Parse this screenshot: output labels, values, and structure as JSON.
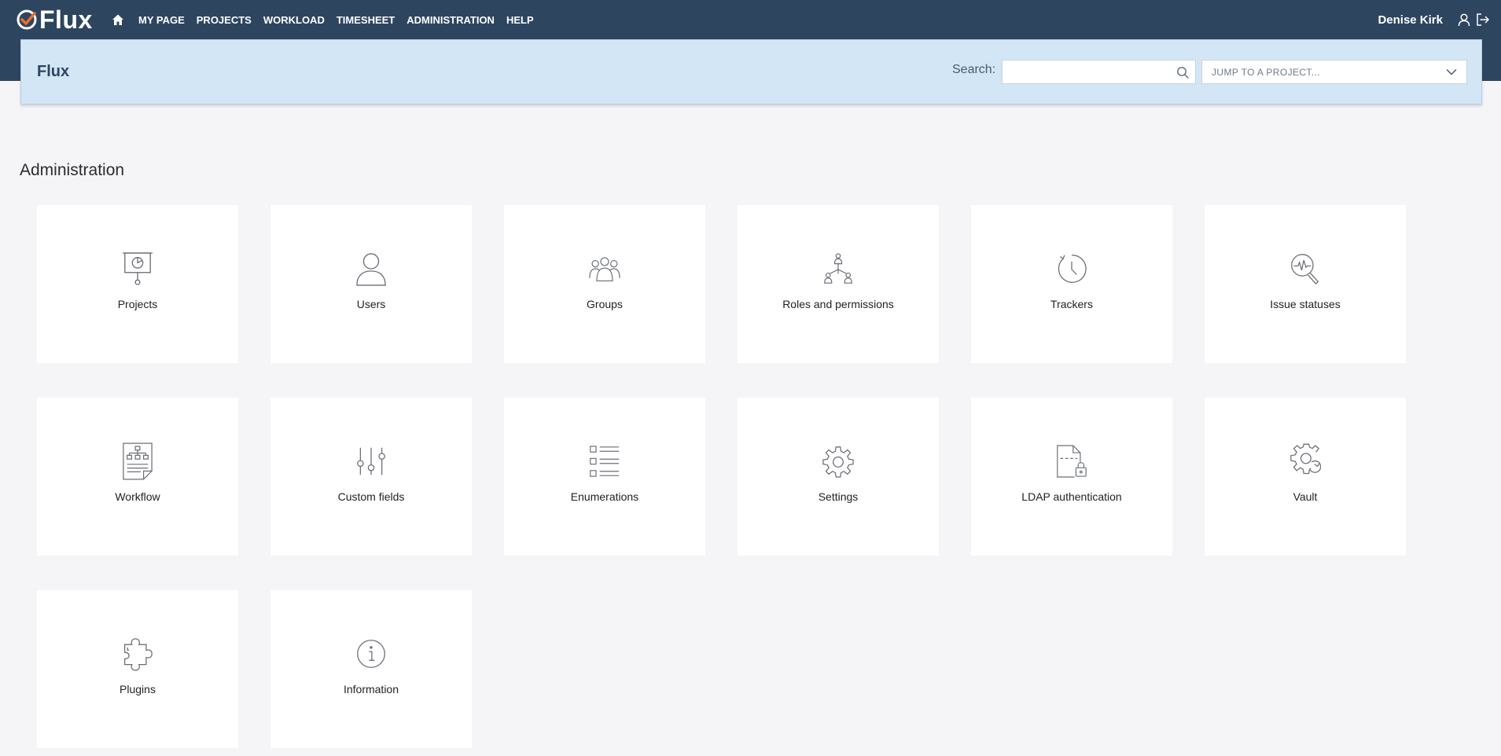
{
  "app": {
    "logo_text": "Flux",
    "brand_color": "#2e4560",
    "accent_color": "#f26b2a"
  },
  "nav": {
    "home_icon": "home-icon",
    "items": [
      {
        "label": "My page"
      },
      {
        "label": "Projects"
      },
      {
        "label": "Workload"
      },
      {
        "label": "Timesheet"
      },
      {
        "label": "Administration"
      },
      {
        "label": "Help"
      }
    ],
    "user_name": "Denise Kirk",
    "user_icon": "user-icon",
    "logout_icon": "logout-icon"
  },
  "header": {
    "title": "Flux",
    "search_label": "Search:",
    "search_value": "",
    "search_placeholder": "",
    "jump_label": "Jump to a project..."
  },
  "page": {
    "heading": "Administration"
  },
  "tiles": [
    {
      "label": "Projects",
      "icon": "presentation-board-icon"
    },
    {
      "label": "Users",
      "icon": "user-icon"
    },
    {
      "label": "Groups",
      "icon": "group-icon"
    },
    {
      "label": "Roles and permissions",
      "icon": "hierarchy-icon"
    },
    {
      "label": "Trackers",
      "icon": "clock-icon"
    },
    {
      "label": "Issue statuses",
      "icon": "magnifier-pulse-icon"
    },
    {
      "label": "Workflow",
      "icon": "workflow-document-icon"
    },
    {
      "label": "Custom fields",
      "icon": "sliders-icon"
    },
    {
      "label": "Enumerations",
      "icon": "list-icon"
    },
    {
      "label": "Settings",
      "icon": "gear-icon"
    },
    {
      "label": "LDAP authentication",
      "icon": "locked-document-icon"
    },
    {
      "label": "Vault",
      "icon": "gear-refresh-icon"
    },
    {
      "label": "Plugins",
      "icon": "puzzle-icon"
    },
    {
      "label": "Information",
      "icon": "info-icon"
    }
  ]
}
